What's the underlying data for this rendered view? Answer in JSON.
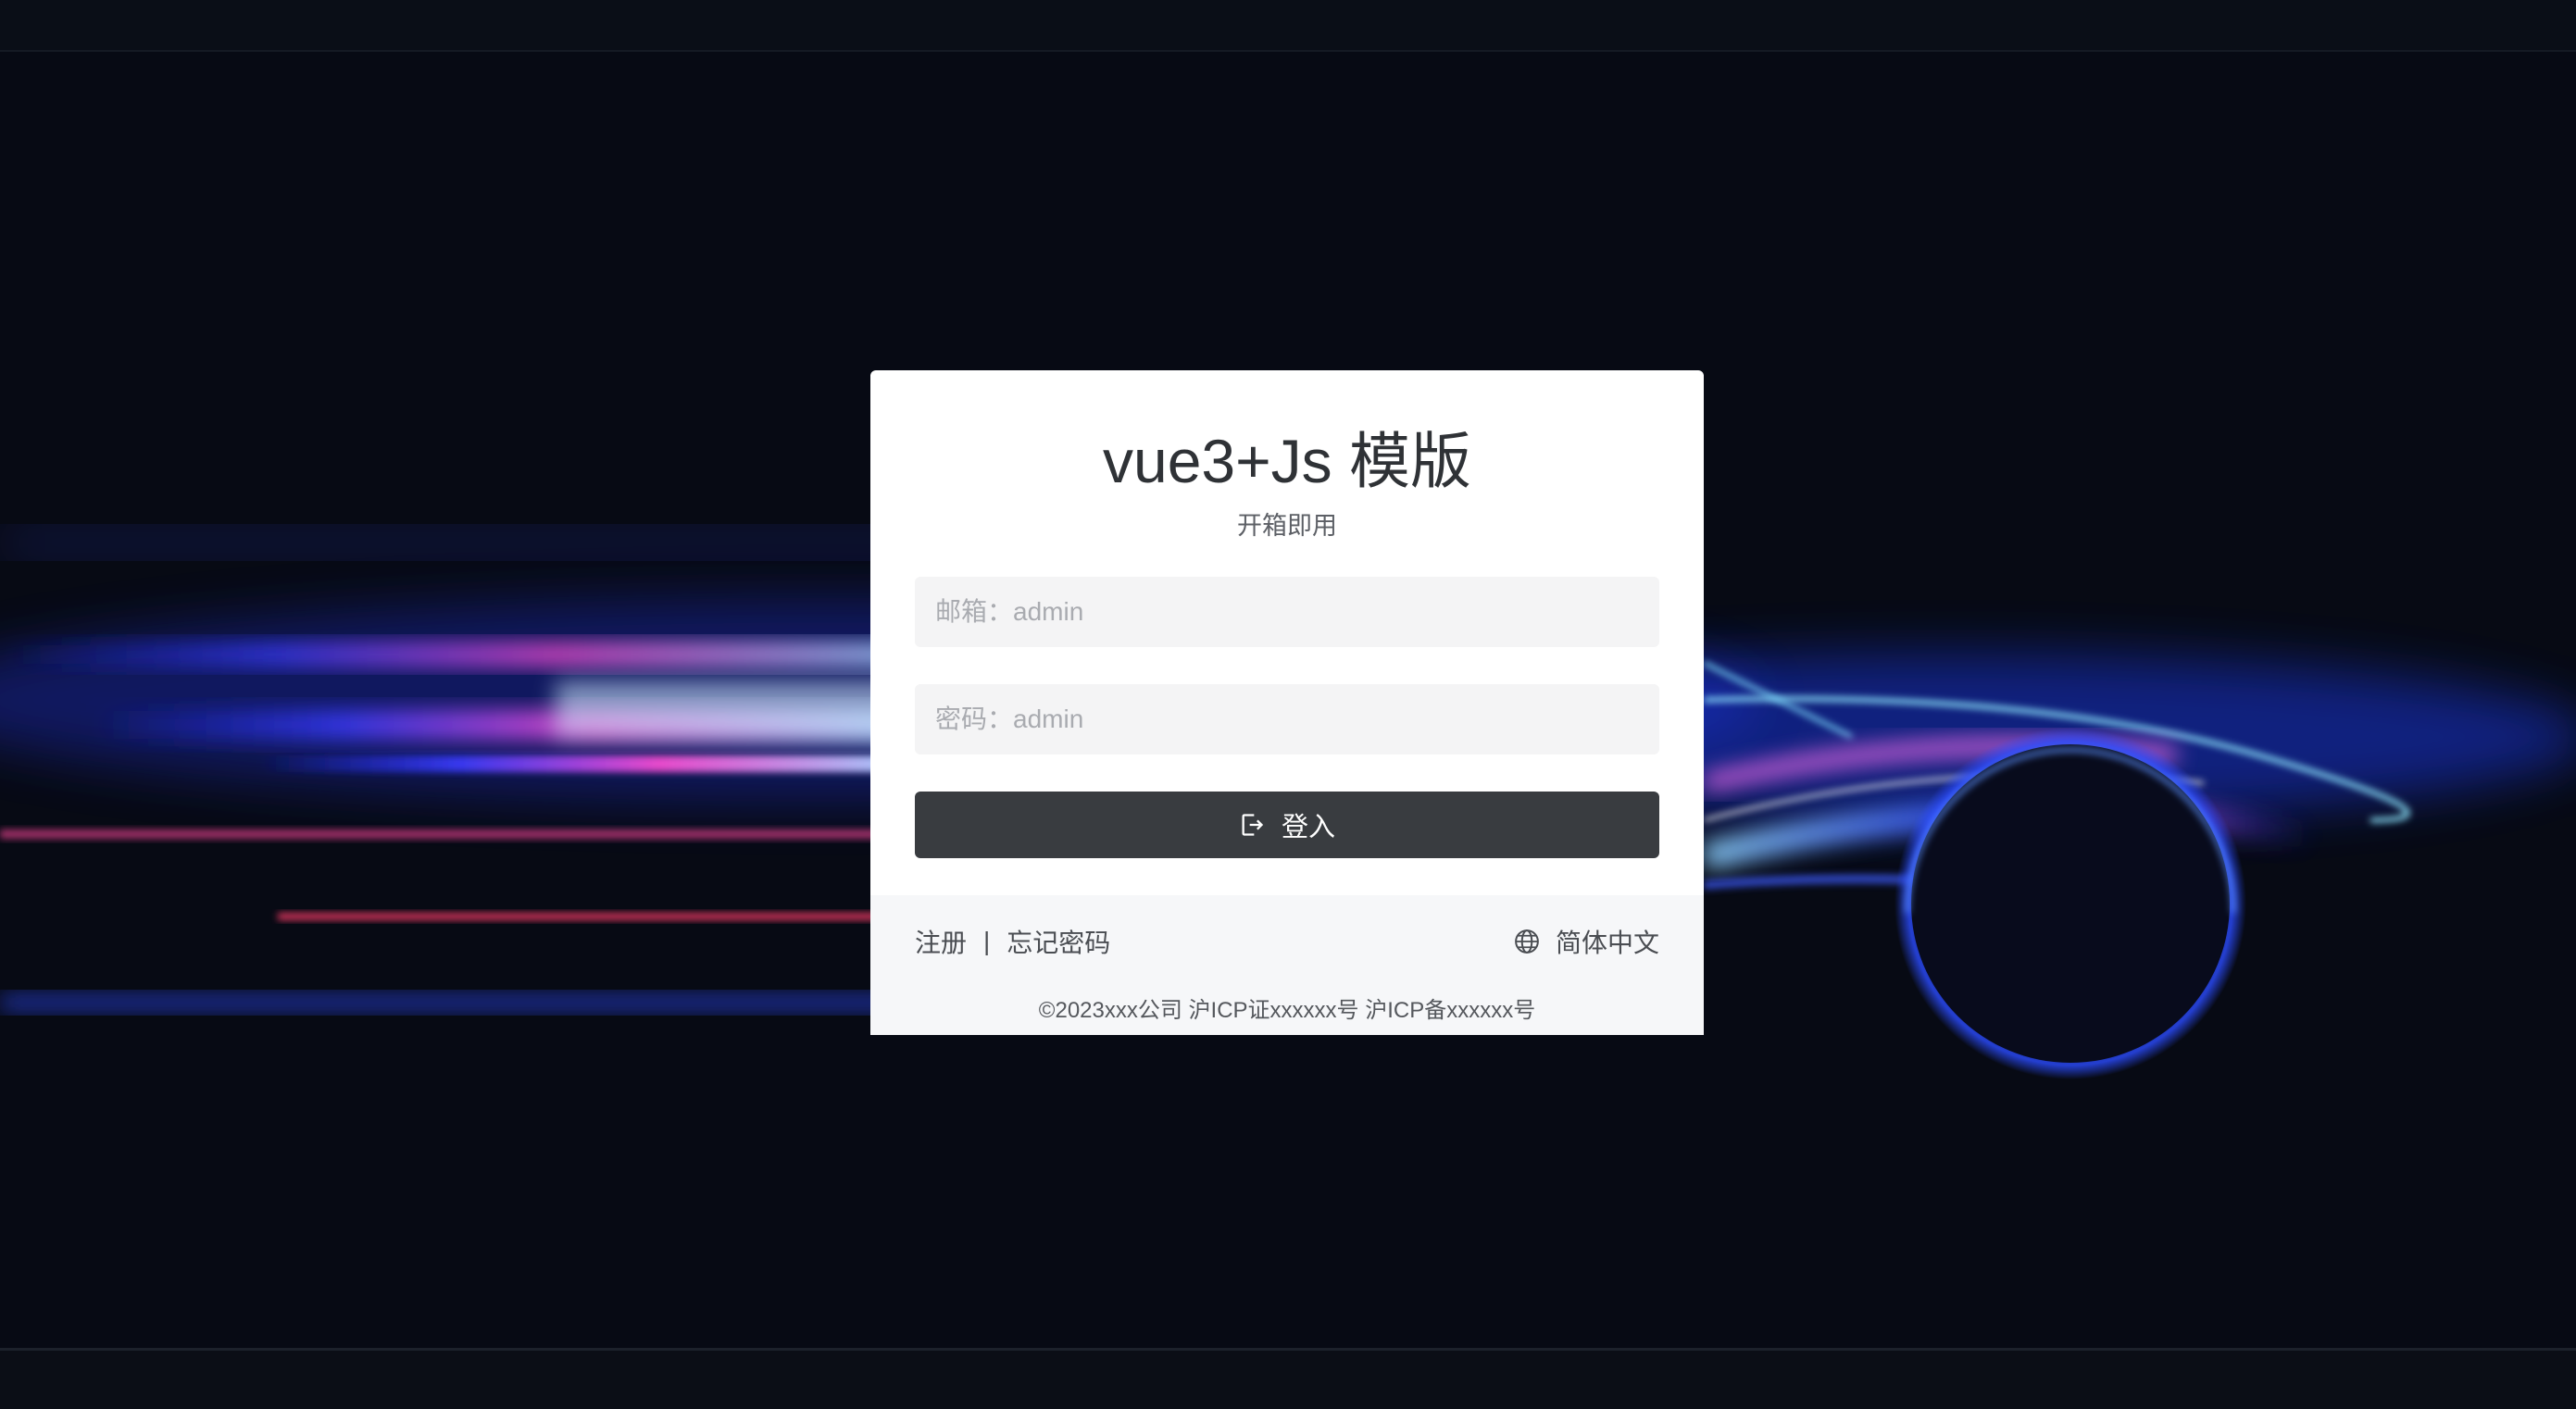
{
  "login": {
    "title": "vue3+Js 模版",
    "subtitle": "开箱即用",
    "email_placeholder": "邮箱：admin",
    "password_placeholder": "密码：admin",
    "submit_label": "登入"
  },
  "footer": {
    "register_label": "注册",
    "separator": "|",
    "forgot_label": "忘记密码",
    "language_label": "简体中文",
    "copyright": "©2023xxx公司 沪ICP证xxxxxx号 沪ICP备xxxxxx号"
  },
  "icons": {
    "login": "login-icon",
    "language": "globe-icon"
  },
  "colors": {
    "background": "#070a14",
    "card": "#ffffff",
    "button": "#393c40",
    "light_streak_blue": "#3a5bff",
    "light_streak_pink": "#ff5ae0",
    "light_streak_cyan": "#7ee8ff"
  }
}
